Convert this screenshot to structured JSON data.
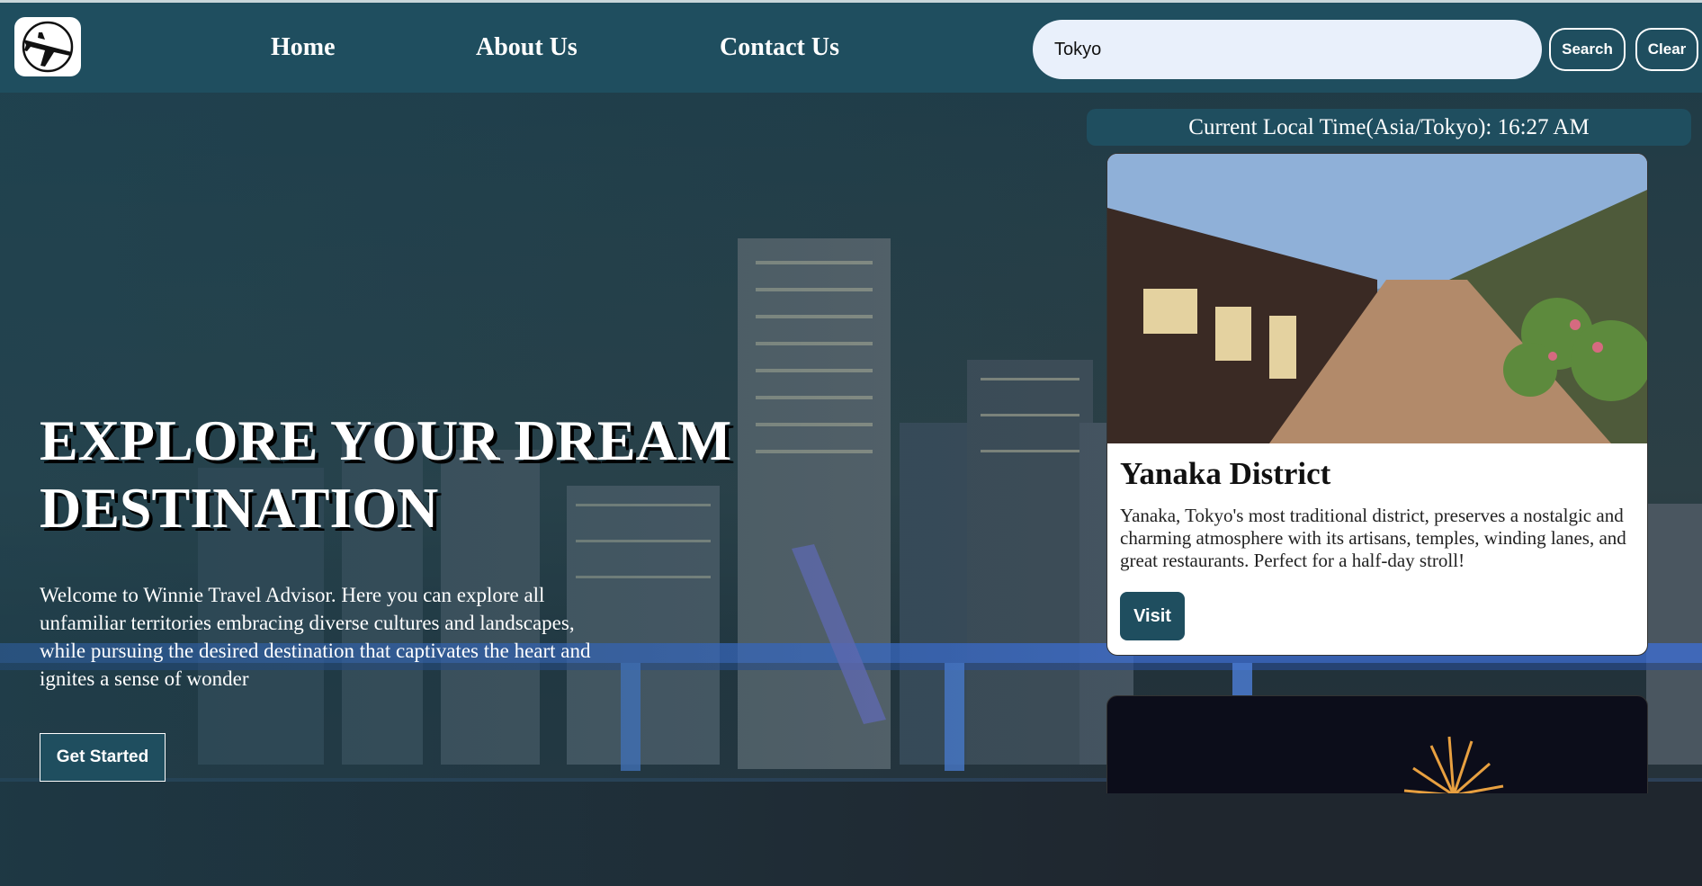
{
  "nav": {
    "links": [
      "Home",
      "About Us",
      "Contact Us"
    ],
    "search_value": "Tokyo",
    "search_button": "Search",
    "clear_button": "Clear",
    "logo_icon": "airplane-logo-icon"
  },
  "hero": {
    "title": "EXPLORE YOUR DREAM DESTINATION",
    "text": "Welcome to Winnie Travel Advisor. Here you can explore all unfamiliar territories embracing diverse cultures and landscapes, while pursuing the desired destination that captivates the heart and ignites a sense of wonder",
    "cta": "Get Started"
  },
  "panel": {
    "time_label": "Current Local Time(Asia/Tokyo): 16:27 AM",
    "cards": [
      {
        "title": "Yanaka District",
        "description": "Yanaka, Tokyo's most traditional district, preserves a nostalgic and charming atmosphere with its artisans, temples, winding lanes, and great restaurants. Perfect for a half-day stroll!",
        "button": "Visit"
      }
    ]
  },
  "colors": {
    "primary": "#1f4e5f",
    "search_bg": "#e9f0fb"
  }
}
